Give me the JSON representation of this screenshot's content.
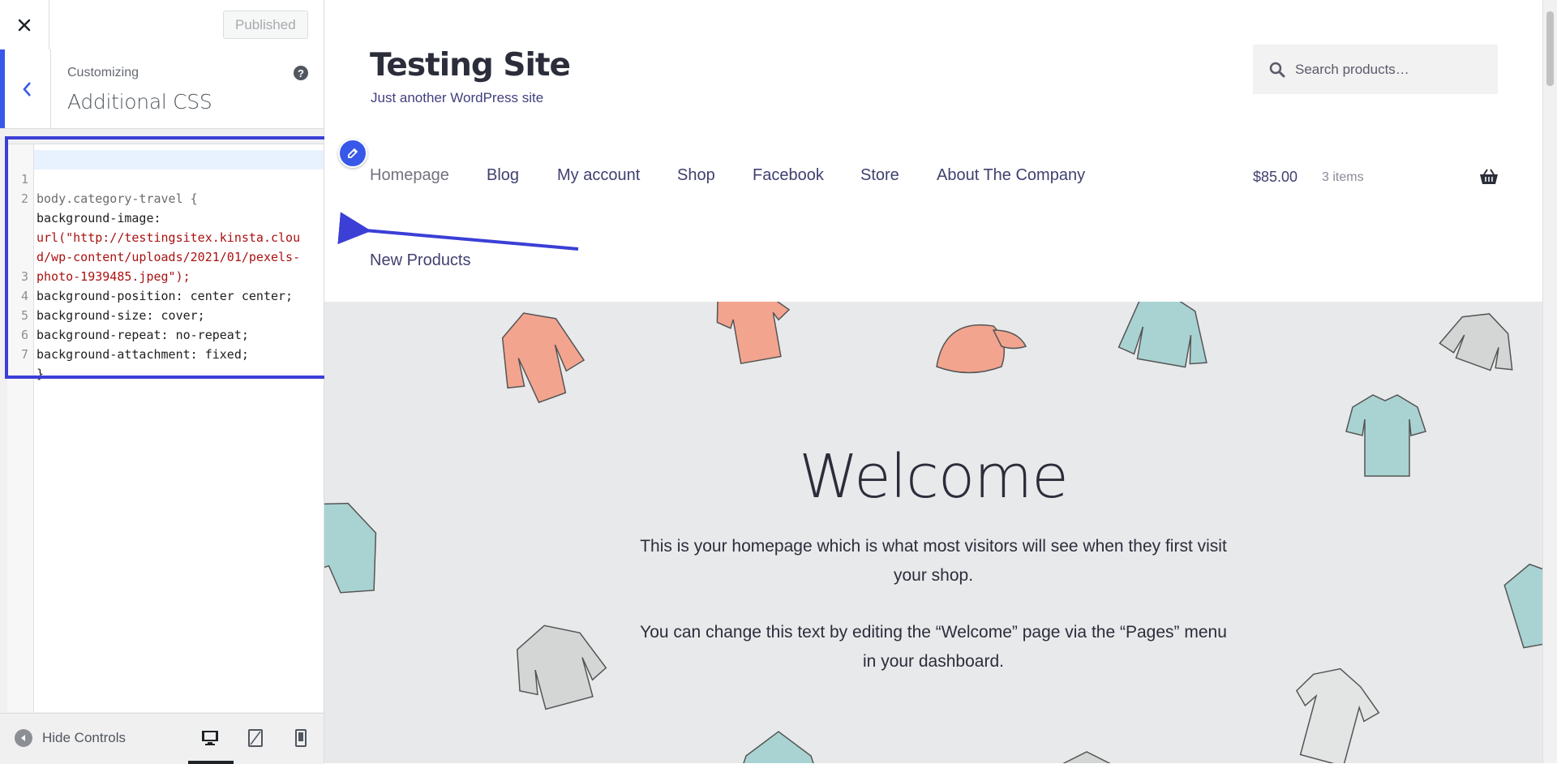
{
  "sidebar": {
    "close_label": "✕",
    "publish_button": "Published",
    "customizing_label": "Customizing",
    "section_title": "Additional CSS",
    "help_glyph": "?",
    "code_lines": [
      {
        "num": "1",
        "text": "body.category-travel {"
      },
      {
        "num": "2",
        "text": "background-image:"
      },
      {
        "num": "",
        "text": "url(\"http://testingsitex.kinsta.clou"
      },
      {
        "num": "",
        "text": "d/wp-content/uploads/2021/01/pexels-"
      },
      {
        "num": "",
        "text": "photo-1939485.jpeg\");"
      },
      {
        "num": "3",
        "text": "background-position: center center;"
      },
      {
        "num": "4",
        "text": "background-size: cover;"
      },
      {
        "num": "5",
        "text": "background-repeat: no-repeat;"
      },
      {
        "num": "6",
        "text": "background-attachment: fixed;"
      },
      {
        "num": "7",
        "text": "}"
      }
    ],
    "footer": {
      "hide_controls": "Hide Controls",
      "devices": [
        "desktop-icon",
        "tablet-icon",
        "mobile-icon"
      ]
    }
  },
  "preview": {
    "site_title": "Testing Site",
    "tagline": "Just another WordPress site",
    "search_placeholder": "Search products…",
    "nav": [
      "Homepage",
      "Blog",
      "My account",
      "Shop",
      "Facebook",
      "Store",
      "About The Company",
      "New Products"
    ],
    "cart": {
      "total": "$85.00",
      "count": "3 items"
    },
    "welcome_title": "Welcome",
    "intro_1": "This is your homepage which is what most visitors will see when they first visit your shop.",
    "intro_2": "You can change this text by editing the “Welcome” page via the “Pages” menu in your dashboard."
  },
  "colors": {
    "accent": "#3858e9",
    "annotation": "#3b3fd6",
    "hero_background": "#e8e9eb"
  }
}
